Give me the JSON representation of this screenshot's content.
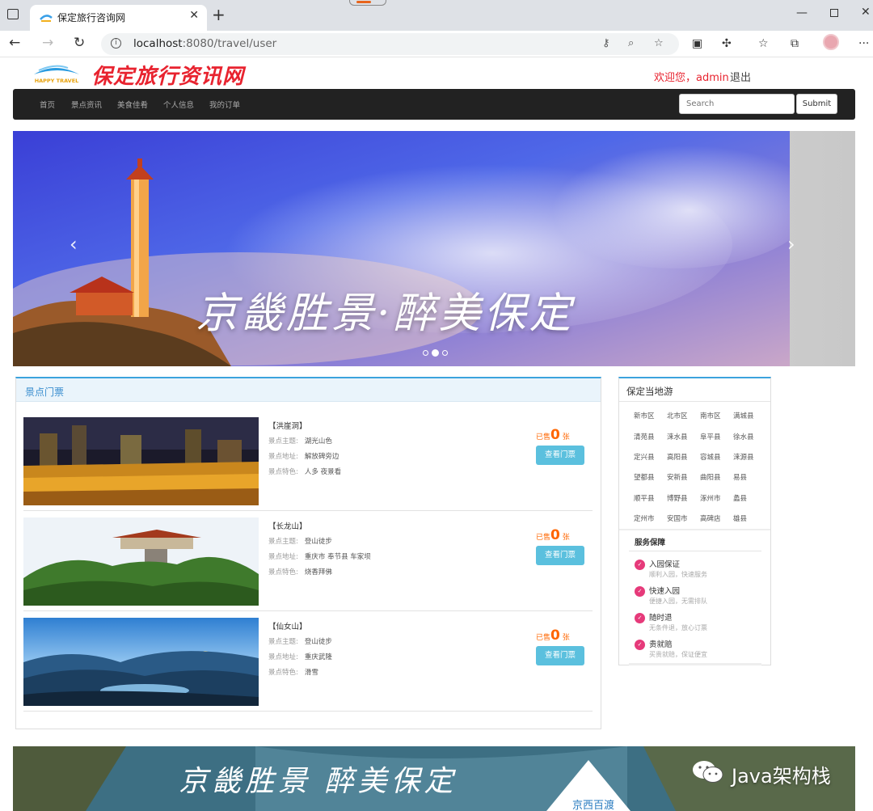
{
  "browser": {
    "tab_title": "保定旅行咨询网",
    "url_host": "localhost",
    "url_rest": ":8080/travel/user"
  },
  "site": {
    "title": "保定旅行资讯网",
    "logo_text": "HAPPY TRAVEL",
    "welcome": "欢迎您，admin",
    "logout": "退出"
  },
  "nav": {
    "items": [
      "首页",
      "景点资讯",
      "美食佳肴",
      "个人信息",
      "我的订单"
    ],
    "search_placeholder": "Search",
    "submit": "Submit"
  },
  "carousel": {
    "caption": "京畿胜景·醉美保定",
    "slide_count": 3,
    "active_slide": 2
  },
  "tickets": {
    "header": "景点门票",
    "labels": {
      "theme": "景点主题:",
      "address": "景点地址:",
      "feature": "景点特色:"
    },
    "sold_prefix": "已售",
    "sold_suffix": "张",
    "buy_label": "查看门票",
    "items": [
      {
        "name": "【洪崖洞】",
        "theme": "湖光山色",
        "address": "解放碑旁边",
        "feature": "人多 夜景看",
        "sold": "0"
      },
      {
        "name": "【长龙山】",
        "theme": "登山徒步",
        "address": "重庆市 奉节县 车家坝",
        "feature": "烧香拜佛",
        "sold": "0"
      },
      {
        "name": "【仙女山】",
        "theme": "登山徒步",
        "address": "重庆武隆",
        "feature": "滑雪",
        "sold": "0"
      }
    ]
  },
  "local": {
    "header": "保定当地游",
    "districts": [
      "新市区",
      "北市区",
      "南市区",
      "满城县",
      "清苑县",
      "涞水县",
      "阜平县",
      "徐水县",
      "定兴县",
      "高阳县",
      "容城县",
      "涞源县",
      "望都县",
      "安新县",
      "曲阳县",
      "易县",
      "顺平县",
      "博野县",
      "涿州市",
      "蠡县",
      "定州市",
      "安国市",
      "高碑店",
      "雄县"
    ],
    "service_header": "服务保障",
    "services": [
      {
        "title": "入园保证",
        "desc": "顺利入园，快速服务"
      },
      {
        "title": "快速入园",
        "desc": "便捷入园，无需排队"
      },
      {
        "title": "随时退",
        "desc": "无条件退，放心订票"
      },
      {
        "title": "贵就赔",
        "desc": "买贵就赔，保证便宜"
      }
    ]
  },
  "bottom_banner": {
    "text": "京畿胜景 醉美保定",
    "sub": "京西百渡"
  },
  "watermark": "Java架构栈"
}
